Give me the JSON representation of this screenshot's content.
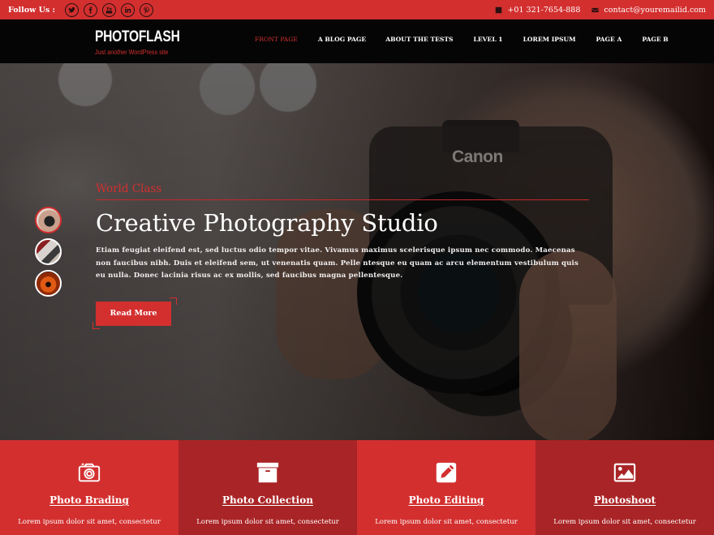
{
  "topbar": {
    "follow_label": "Follow Us :",
    "social": [
      {
        "icon": "twitter-icon",
        "glyph": "t"
      },
      {
        "icon": "facebook-icon",
        "glyph": "f"
      },
      {
        "icon": "youtube-icon",
        "glyph": "You"
      },
      {
        "icon": "linkedin-icon",
        "glyph": "in"
      },
      {
        "icon": "pinterest-icon",
        "glyph": "P"
      }
    ],
    "phone": "+01 321-7654-888",
    "email": "contact@youremailid.com"
  },
  "header": {
    "site_title": "PHOTOFLASH",
    "tagline": "Just another WordPress site",
    "nav": [
      {
        "label": "FRONT PAGE",
        "active": true
      },
      {
        "label": "A BLOG PAGE",
        "active": false
      },
      {
        "label": "ABOUT THE TESTS",
        "active": false
      },
      {
        "label": "LEVEL 1",
        "active": false
      },
      {
        "label": "LOREM IPSUM",
        "active": false
      },
      {
        "label": "PAGE A",
        "active": false
      },
      {
        "label": "PAGE B",
        "active": false
      }
    ]
  },
  "hero": {
    "camera_brand": "Canon",
    "kicker": "World Class",
    "title": "Creative Photography Studio",
    "description": "Etiam feugiat eleifend est, sed luctus odio tempor vitae. Vivamus maximus scelerisque ipsum nec commodo. Maecenas non faucibus nibh. Duis et eleifend sem, ut venenatis quam. Pelle ntesque eu quam ac arcu elementum vestibulum quis eu nulla. Donec lacinia risus ac ex mollis, sed faucibus magna pellentesque.",
    "button_label": "Read More",
    "slides_count": 3,
    "active_slide": 1
  },
  "features": [
    {
      "icon": "camera-icon",
      "title": "Photo Brading",
      "text": "Lorem ipsum dolor sit amet, consectetur"
    },
    {
      "icon": "archive-box-icon",
      "title": "Photo Collection",
      "text": "Lorem ipsum dolor sit amet, consectetur"
    },
    {
      "icon": "edit-pencil-icon",
      "title": "Photo Editing",
      "text": "Lorem ipsum dolor sit amet, consectetur"
    },
    {
      "icon": "image-icon",
      "title": "Photoshoot",
      "text": "Lorem ipsum dolor sit amet, consectetur"
    }
  ],
  "colors": {
    "accent": "#d32f2f",
    "accent_dark": "#a92426",
    "header_bg": "#050505"
  }
}
